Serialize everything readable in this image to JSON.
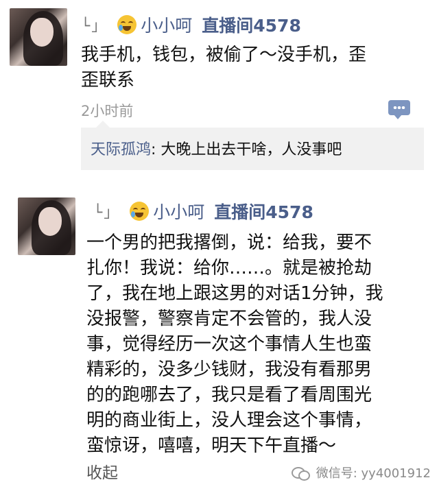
{
  "post1": {
    "reply_mark": "└」",
    "name": "小小呵",
    "room": "直播间4578",
    "lines": [
      "我手机，钱包，被偷了～没手机，歪",
      "歪联系"
    ],
    "time": "2小时前",
    "comment": {
      "name": "天际孤鸿",
      "separator": ": ",
      "text": "大晚上出去干啥，人没事吧"
    }
  },
  "post2": {
    "reply_mark": "└」",
    "name": "小小呵",
    "room": "直播间4578",
    "lines": [
      "一个男的把我撂倒，说：给我，要不",
      "扎你！我说：给你……。就是被抢劫",
      "了，我在地上跟这男的对话1分钟，我",
      "没报警，警察肯定不会管的，我人没",
      "事，觉得经历一次这个事情人生也蛮",
      "精彩的，没多少钱财，我没有看那男",
      "的的跑哪去了，我只是看了看周围光",
      "明的商业街上，没人理会这个事情，",
      "蛮惊讶，嘻嘻，明天下午直播～"
    ],
    "collapse": "收起"
  },
  "watermark": {
    "label": "微信号: ",
    "id": "yy4001912"
  },
  "icons": {
    "emoji": "crying-laughing-emoji-icon",
    "comment": "comment-bubble-icon",
    "wechat": "wechat-icon"
  },
  "colors": {
    "name_blue": "#4a5e8a",
    "comment_bg": "#f1f1f1",
    "icon_blue": "#7d95c0"
  }
}
